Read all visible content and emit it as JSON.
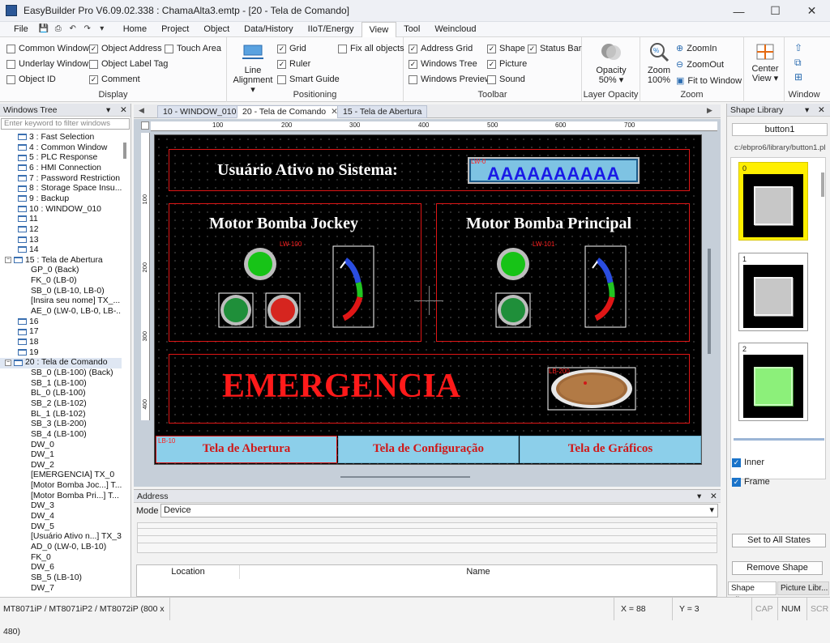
{
  "window": {
    "title": "EasyBuilder Pro V6.09.02.338 : ChamaAlta3.emtp - [20 - Tela de Comando]"
  },
  "menu": [
    "File",
    "Home",
    "Project",
    "Object",
    "Data/History",
    "IIoT/Energy",
    "View",
    "Tool",
    "Weincloud"
  ],
  "ribbon": {
    "display": {
      "label": "Display",
      "items": [
        {
          "text": "Common Window",
          "checked": false
        },
        {
          "text": "Object Address",
          "checked": true
        },
        {
          "text": "Touch Area",
          "checked": false
        },
        {
          "text": "Underlay Window",
          "checked": false
        },
        {
          "text": "Object Label Tag",
          "checked": false
        },
        {
          "text": "Object ID",
          "checked": false
        },
        {
          "text": "Comment",
          "checked": true
        }
      ]
    },
    "positioning": {
      "label": "Positioning",
      "line_alignment": "Line Alignment",
      "items": [
        {
          "text": "Grid",
          "checked": true
        },
        {
          "text": "Fix all objects",
          "checked": false
        },
        {
          "text": "Ruler",
          "checked": true
        },
        {
          "text": "Smart Guide",
          "checked": false
        }
      ]
    },
    "toolbar": {
      "label": "Toolbar",
      "items": [
        {
          "text": "Address Grid",
          "checked": true
        },
        {
          "text": "Shape",
          "checked": true
        },
        {
          "text": "Status Bar",
          "checked": true
        },
        {
          "text": "Windows Tree",
          "checked": true
        },
        {
          "text": "Picture",
          "checked": true
        },
        {
          "text": "Windows Preview",
          "checked": false
        },
        {
          "text": "Sound",
          "checked": false
        }
      ]
    },
    "layer_opacity": {
      "label": "Layer Opacity",
      "opacity": "Opacity",
      "value": "50%"
    },
    "zoom": {
      "label": "Zoom",
      "zoom": "Zoom",
      "value": "100%",
      "zoomin": "ZoomIn",
      "zoomout": "ZoomOut",
      "fit": "Fit to Window"
    },
    "window": {
      "label": "Window",
      "center": "Center",
      "view": "View"
    }
  },
  "windows_tree": {
    "title": "Windows Tree",
    "filter_placeholder": "Enter keyword to filter windows",
    "items": [
      {
        "text": "3 : Fast Selection",
        "level": 1,
        "type": "win"
      },
      {
        "text": "4 : Common Window",
        "level": 1,
        "type": "win"
      },
      {
        "text": "5 : PLC Response",
        "level": 1,
        "type": "win"
      },
      {
        "text": "6 : HMI Connection",
        "level": 1,
        "type": "win"
      },
      {
        "text": "7 : Password Restriction",
        "level": 1,
        "type": "win"
      },
      {
        "text": "8 : Storage Space Insu...",
        "level": 1,
        "type": "win"
      },
      {
        "text": "9 : Backup",
        "level": 1,
        "type": "win"
      },
      {
        "text": "10 : WINDOW_010",
        "level": 1,
        "type": "win"
      },
      {
        "text": "11",
        "level": 1,
        "type": "win"
      },
      {
        "text": "12",
        "level": 1,
        "type": "win"
      },
      {
        "text": "13",
        "level": 1,
        "type": "win"
      },
      {
        "text": "14",
        "level": 1,
        "type": "win"
      },
      {
        "text": "15 : Tela de Abertura",
        "level": 0,
        "type": "open"
      },
      {
        "text": "GP_0 (Back)",
        "level": 2,
        "type": "obj"
      },
      {
        "text": "FK_0 (LB-0)",
        "level": 2,
        "type": "obj"
      },
      {
        "text": "SB_0 (LB-10, LB-0)",
        "level": 2,
        "type": "obj"
      },
      {
        "text": "[Insira seu nome] TX_...",
        "level": 2,
        "type": "obj"
      },
      {
        "text": "AE_0 (LW-0, LB-0, LB-...",
        "level": 2,
        "type": "obj"
      },
      {
        "text": "16",
        "level": 1,
        "type": "win"
      },
      {
        "text": "17",
        "level": 1,
        "type": "win"
      },
      {
        "text": "18",
        "level": 1,
        "type": "win"
      },
      {
        "text": "19",
        "level": 1,
        "type": "win"
      },
      {
        "text": "20 : Tela de Comando",
        "level": 0,
        "type": "open",
        "selected": true
      },
      {
        "text": "SB_0 (LB-100) (Back)",
        "level": 2,
        "type": "obj"
      },
      {
        "text": "SB_1 (LB-100)",
        "level": 2,
        "type": "obj"
      },
      {
        "text": "BL_0 (LB-100)",
        "level": 2,
        "type": "obj"
      },
      {
        "text": "SB_2 (LB-102)",
        "level": 2,
        "type": "obj"
      },
      {
        "text": "BL_1 (LB-102)",
        "level": 2,
        "type": "obj"
      },
      {
        "text": "SB_3 (LB-200)",
        "level": 2,
        "type": "obj"
      },
      {
        "text": "SB_4 (LB-100)",
        "level": 2,
        "type": "obj"
      },
      {
        "text": "DW_0",
        "level": 2,
        "type": "obj"
      },
      {
        "text": "DW_1",
        "level": 2,
        "type": "obj"
      },
      {
        "text": "DW_2",
        "level": 2,
        "type": "obj"
      },
      {
        "text": "[EMERGENCIA] TX_0",
        "level": 2,
        "type": "obj"
      },
      {
        "text": "[Motor Bomba Joc...] T...",
        "level": 2,
        "type": "obj"
      },
      {
        "text": "[Motor Bomba Pri...] T...",
        "level": 2,
        "type": "obj"
      },
      {
        "text": "DW_3",
        "level": 2,
        "type": "obj"
      },
      {
        "text": "DW_4",
        "level": 2,
        "type": "obj"
      },
      {
        "text": "DW_5",
        "level": 2,
        "type": "obj"
      },
      {
        "text": "[Usuário Ativo n...] TX_3",
        "level": 2,
        "type": "obj"
      },
      {
        "text": "AD_0 (LW-0, LB-10)",
        "level": 2,
        "type": "obj"
      },
      {
        "text": "FK_0",
        "level": 2,
        "type": "obj"
      },
      {
        "text": "DW_6",
        "level": 2,
        "type": "obj"
      },
      {
        "text": "SB_5 (LB-10)",
        "level": 2,
        "type": "obj"
      },
      {
        "text": "DW_7",
        "level": 2,
        "type": "obj"
      }
    ]
  },
  "tabs": [
    {
      "label": "10 - WINDOW_010",
      "active": false
    },
    {
      "label": "20 - Tela de Comando",
      "active": true
    },
    {
      "label": "15 - Tela de Abertura",
      "active": false
    }
  ],
  "ruler": [
    "100",
    "200",
    "300",
    "400",
    "500",
    "600",
    "700"
  ],
  "ruler_v": [
    "100",
    "200",
    "300",
    "400"
  ],
  "hmi": {
    "user_label": "Usuário Ativo no Sistema:",
    "user_value": "AAAAAAAAAA",
    "user_tag": "LW-0",
    "motor1_title": "Motor Bomba Jockey",
    "motor2_title": "Motor Bomba Principal",
    "motor1_tag": "LW-100",
    "motor2_tag": "LW-101",
    "emergency": "EMERGENCIA",
    "emergency_tag": "LB-200",
    "nav_tag": "LB-10",
    "nav_buttons": [
      "Tela de Abertura",
      "Tela de Configuração",
      "Tela de Gráficos"
    ]
  },
  "address_pane": {
    "title": "Address",
    "mode_label": "Mode",
    "mode_value": "Device",
    "columns": [
      "Location",
      "Name"
    ]
  },
  "shape_library": {
    "title": "Shape Library",
    "name": "button1",
    "path": "c:/ebpro6/library/button1.pl",
    "states": [
      "0",
      "1",
      "2"
    ],
    "inner": "Inner",
    "frame": "Frame",
    "set_all": "Set to All States",
    "remove": "Remove Shape",
    "tabs": [
      "Shape Libr...",
      "Picture Libr..."
    ]
  },
  "status": {
    "model": "MT8071iP / MT8071iP2 / MT8072iP (800 x 480)",
    "x": "X = 88",
    "y": "Y = 3",
    "cap": "CAP",
    "num": "NUM",
    "scr": "SCR"
  },
  "colors": {
    "accent": "#1a73c9",
    "hmi_red": "#e01616",
    "hmi_button": "#8ccfea"
  }
}
